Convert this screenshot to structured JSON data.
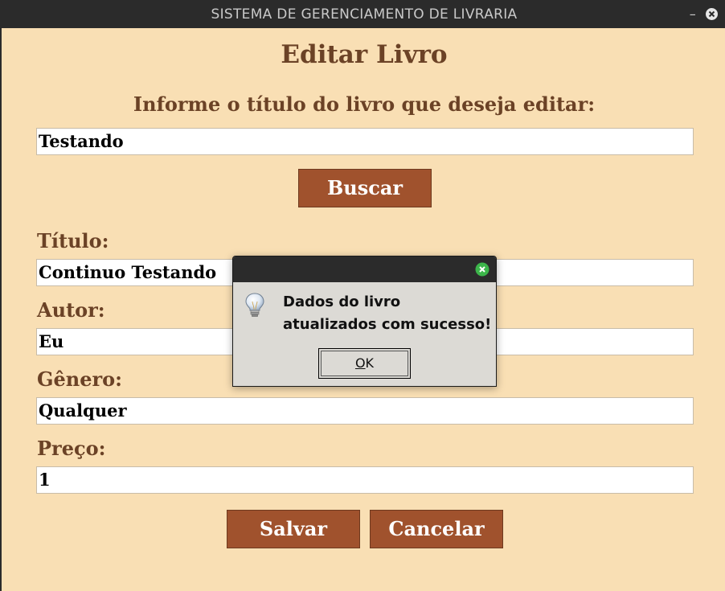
{
  "window": {
    "title": "SISTEMA DE GERENCIAMENTO DE LIVRARIA",
    "minimize_glyph": "–"
  },
  "page": {
    "title": "Editar Livro",
    "prompt": "Informe o título do livro que deseja editar:",
    "search_value": "Testando",
    "search_button": "Buscar"
  },
  "form": {
    "titulo_label": "Título:",
    "titulo_value": "Continuo Testando",
    "autor_label": "Autor:",
    "autor_value": "Eu",
    "genero_label": "Gênero:",
    "genero_value": "Qualquer",
    "preco_label": "Preço:",
    "preco_value": "1"
  },
  "actions": {
    "save_label": "Salvar",
    "cancel_label": "Cancelar"
  },
  "dialog": {
    "message": "Dados do livro atualizados com sucesso!",
    "ok_mnemonic": "O",
    "ok_rest": "K",
    "icon": "lightbulb-icon"
  },
  "colors": {
    "background": "#f9dfb4",
    "heading": "#6b4226",
    "button": "#a0522d",
    "titlebar": "#2b2b2b",
    "dialog_close": "#3cb54a"
  }
}
